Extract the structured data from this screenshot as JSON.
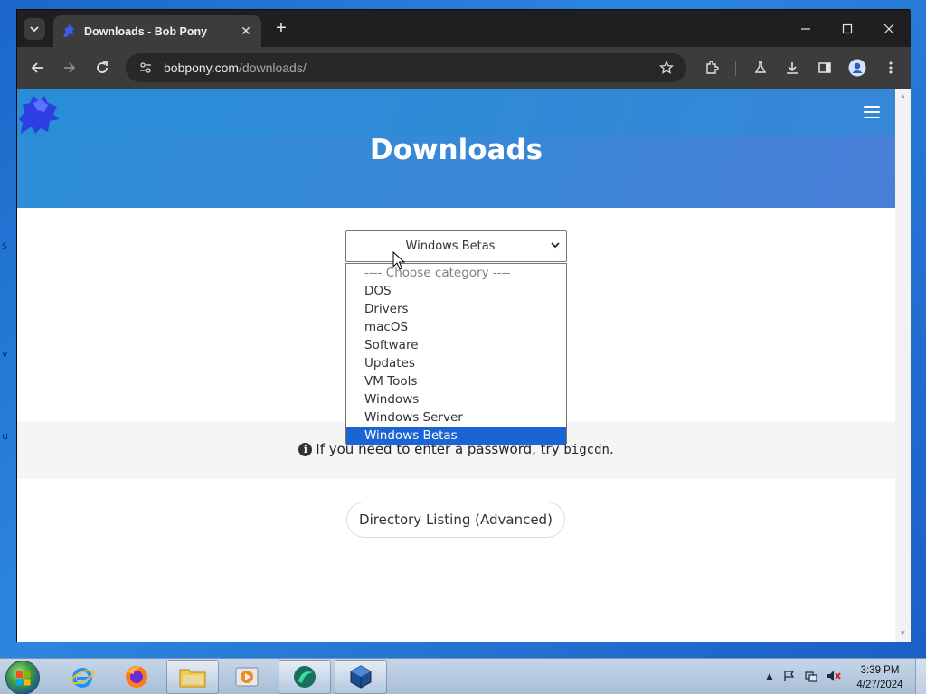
{
  "browser": {
    "tab_title": "Downloads - Bob Pony",
    "url_domain": "bobpony.com",
    "url_path": "/downloads/"
  },
  "page": {
    "title": "Downloads",
    "select_value": "Windows Betas",
    "options": [
      "---- Choose category ----",
      "DOS",
      "Drivers",
      "macOS",
      "Software",
      "Updates",
      "VM Tools",
      "Windows",
      "Windows Server",
      "Windows Betas"
    ],
    "selected_index": 9,
    "info_text": "If you need to enter a password, try ",
    "info_password": "bigcdn",
    "info_suffix": ".",
    "directory_button": "Directory Listing (Advanced)"
  },
  "taskbar": {
    "time": "3:39 PM",
    "date": "4/27/2024"
  },
  "colors": {
    "hero": "#3b86d6",
    "selected_option": "#1a64d4"
  }
}
